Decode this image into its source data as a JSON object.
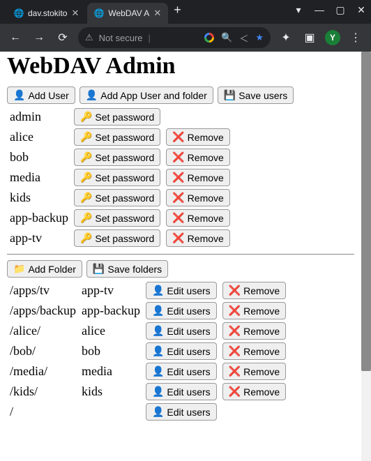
{
  "browser": {
    "tabs": [
      {
        "label": "dav.stokito",
        "active": false
      },
      {
        "label": "WebDAV A",
        "active": true
      }
    ],
    "omnibox": {
      "security_text": "Not secure"
    },
    "avatar_letter": "Y"
  },
  "page": {
    "title": "WebDAV Admin",
    "user_buttons": {
      "add_user": "Add User",
      "add_app_user": "Add App User and folder",
      "save_users": "Save users"
    },
    "set_password_label": "Set password",
    "remove_label": "Remove",
    "users": [
      {
        "name": "admin",
        "removable": false
      },
      {
        "name": "alice",
        "removable": true
      },
      {
        "name": "bob",
        "removable": true
      },
      {
        "name": "media",
        "removable": true
      },
      {
        "name": "kids",
        "removable": true
      },
      {
        "name": "app-backup",
        "removable": true
      },
      {
        "name": "app-tv",
        "removable": true
      }
    ],
    "folder_buttons": {
      "add_folder": "Add Folder",
      "save_folders": "Save folders"
    },
    "edit_users_label": "Edit users",
    "folders": [
      {
        "path": "/apps/tv",
        "owner": "app-tv",
        "removable": true
      },
      {
        "path": "/apps/backup",
        "owner": "app-backup",
        "removable": true
      },
      {
        "path": "/alice/",
        "owner": "alice",
        "removable": true
      },
      {
        "path": "/bob/",
        "owner": "bob",
        "removable": true
      },
      {
        "path": "/media/",
        "owner": "media",
        "removable": true
      },
      {
        "path": "/kids/",
        "owner": "kids",
        "removable": true
      },
      {
        "path": "/",
        "owner": "",
        "removable": false
      }
    ]
  }
}
